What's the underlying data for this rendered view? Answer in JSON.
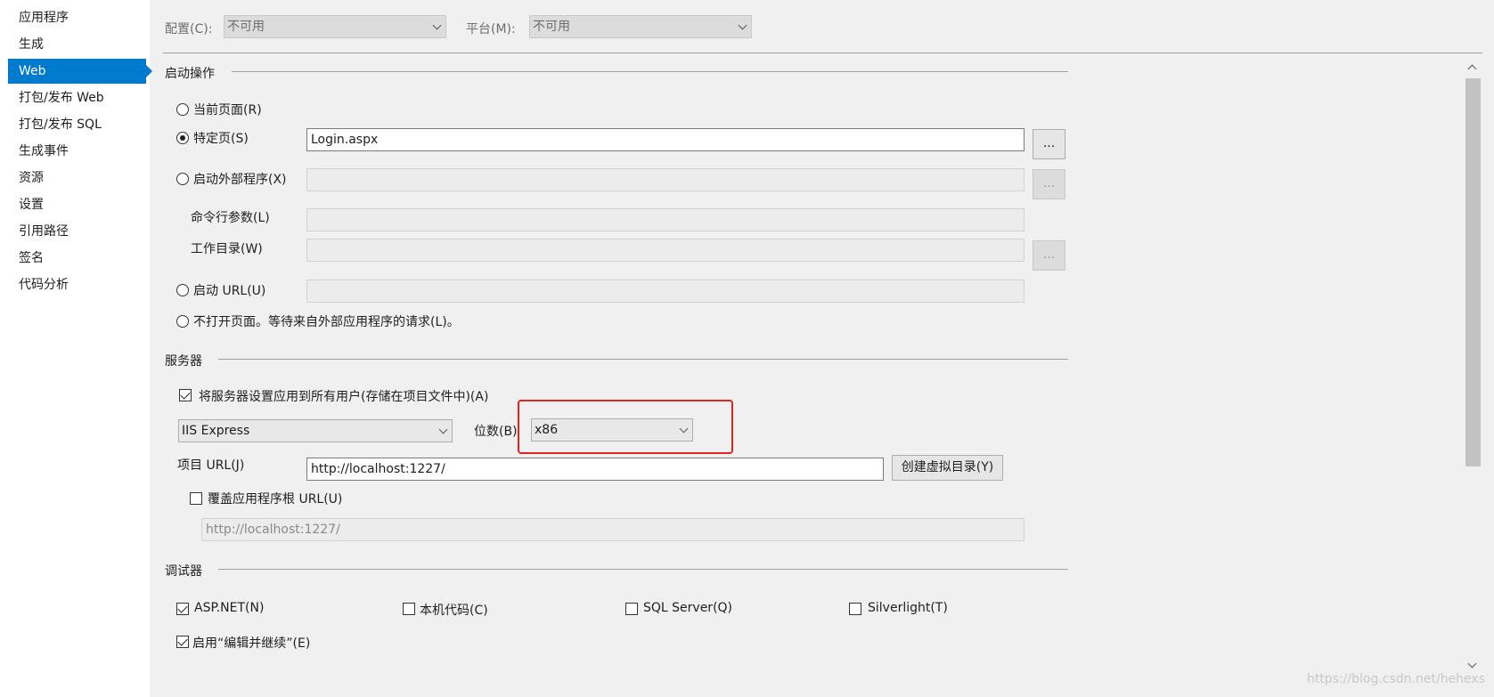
{
  "sidebar": {
    "items": [
      {
        "label": "应用程序"
      },
      {
        "label": "生成"
      },
      {
        "label": "Web",
        "active": true
      },
      {
        "label": "打包/发布 Web"
      },
      {
        "label": "打包/发布 SQL"
      },
      {
        "label": "生成事件"
      },
      {
        "label": "资源"
      },
      {
        "label": "设置"
      },
      {
        "label": "引用路径"
      },
      {
        "label": "签名"
      },
      {
        "label": "代码分析"
      }
    ]
  },
  "toolbar": {
    "config_label": "配置(C):",
    "config_value": "不可用",
    "platform_label": "平台(M):",
    "platform_value": "不可用"
  },
  "start_action": {
    "heading": "启动操作",
    "current_page": "当前页面(R)",
    "specific_page": "特定页(S)",
    "specific_page_value": "Login.aspx",
    "browse": "...",
    "start_external": "启动外部程序(X)",
    "cmd_args": "命令行参数(L)",
    "working_dir": "工作目录(W)",
    "start_url": "启动 URL(U)",
    "dont_open": "不打开页面。等待来自外部应用程序的请求(L)。",
    "selected": "specific_page"
  },
  "servers": {
    "heading": "服务器",
    "apply_all_users": "将服务器设置应用到所有用户(存储在项目文件中)(A)",
    "apply_all_users_checked": true,
    "server_value": "IIS Express",
    "bitness_label": "位数(B)",
    "bitness_value": "x86",
    "project_url_label": "项目 URL(J)",
    "project_url_value": "http://localhost:1227/",
    "create_vdir": "创建虚拟目录(Y)",
    "override_root": "覆盖应用程序根 URL(U)",
    "override_root_checked": false,
    "override_root_value": "http://localhost:1227/"
  },
  "debuggers": {
    "heading": "调试器",
    "items": [
      {
        "label": "ASP.NET(N)",
        "checked": true
      },
      {
        "label": "本机代码(C)",
        "checked": false
      },
      {
        "label": "SQL Server(Q)",
        "checked": false
      },
      {
        "label": "Silverlight(T)",
        "checked": false
      }
    ],
    "edit_continue": "启用“编辑并继续”(E)",
    "edit_continue_checked": true
  },
  "watermark": "https://blog.csdn.net/hehexs",
  "colors": {
    "accent": "#007acc",
    "highlight_box": "#e0241f"
  }
}
